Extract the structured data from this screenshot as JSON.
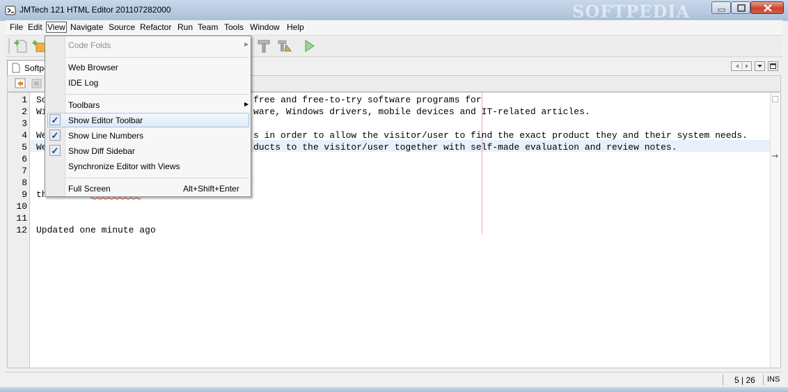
{
  "window": {
    "title": "JMTech 121 HTML Editor 201107282000",
    "watermark": "SOFTPEDIA"
  },
  "menubar": {
    "items": [
      "File",
      "Edit",
      "View",
      "Navigate",
      "Source",
      "Refactor",
      "Run",
      "Team",
      "Tools",
      "Window",
      "Help"
    ],
    "active": "View"
  },
  "tab": {
    "label": "Softpe"
  },
  "editor": {
    "lines": [
      {
        "num": "1",
        "text": "So"
      },
      {
        "num": "2",
        "text": "Wi"
      },
      {
        "num": "3",
        "text": ""
      },
      {
        "num": "4",
        "text": "We"
      },
      {
        "num": "5",
        "text": "We"
      },
      {
        "num": "6",
        "text": ""
      },
      {
        "num": "7",
        "text": ""
      },
      {
        "num": "8",
        "text": ""
      },
      {
        "num": "9",
        "text": "th"
      },
      {
        "num": "10",
        "text": ""
      },
      {
        "num": "11",
        "text": ""
      },
      {
        "num": "12",
        "text": "Updated one minute ago"
      }
    ],
    "visible_right": {
      "line1": "free and free-to-try software programs for",
      "line2": "ware, Windows drivers, mobile devices and IT-related articles.",
      "line4": "s in order to allow the visitor/user to find the exact product they and their system needs.",
      "line5": "ducts to the visitor/user together with self-made evaluation and review notes."
    }
  },
  "view_menu": {
    "items": {
      "code_folds": "Code Folds",
      "web_browser": "Web Browser",
      "ide_log": "IDE Log",
      "toolbars": "Toolbars",
      "show_editor_toolbar": "Show Editor Toolbar",
      "show_line_numbers": "Show Line Numbers",
      "show_diff_sidebar": "Show Diff Sidebar",
      "synchronize": "Synchronize Editor with Views",
      "full_screen": "Full Screen",
      "full_screen_shortcut": "Alt+Shift+Enter"
    },
    "check_mark": "✓"
  },
  "statusbar": {
    "position": "5 | 26",
    "mode": "INS"
  },
  "colors": {
    "titlebar": "#b6c9df",
    "check": "#1b3f9a",
    "margin_line": "#e8a8a8",
    "current_line": "#e8f0fb"
  }
}
